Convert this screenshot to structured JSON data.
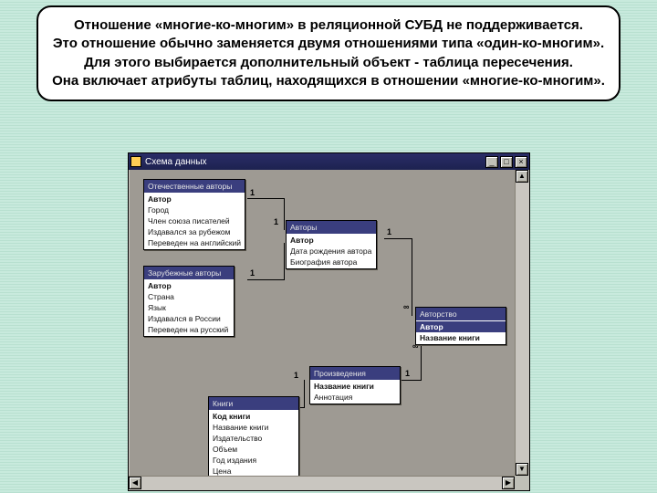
{
  "callout": "Отношение «многие-ко-многим» в реляционной СУБД не поддерживается.\nЭто отношение обычно заменяется двумя отношениями типа «один-ко-многим». Для этого выбирается дополнительный объект - таблица пересечения.\nОна включает атрибуты таблиц, находящихся в отношении «многие-ко-многим».",
  "window": {
    "title": "Схема данных",
    "btn_min": "_",
    "btn_max": "□",
    "btn_close": "×",
    "sb_up": "▲",
    "sb_down": "▼",
    "sb_left": "◀",
    "sb_right": "▶"
  },
  "tables": {
    "t1": {
      "title": "Отечественные авторы",
      "f0": "Автор",
      "f1": "Город",
      "f2": "Член союза писателей",
      "f3": "Издавался за рубежом",
      "f4": "Переведен на английский"
    },
    "t2": {
      "title": "Авторы",
      "f0": "Автор",
      "f1": "Дата рождения автора",
      "f2": "Биография автора"
    },
    "t3": {
      "title": "Зарубежные авторы",
      "f0": "Автор",
      "f1": "Страна",
      "f2": "Язык",
      "f3": "Издавался в России",
      "f4": "Переведен на русский"
    },
    "t4": {
      "title": "Авторство",
      "f0": "Автор",
      "f1": "Название книги"
    },
    "t5": {
      "title": "Произведения",
      "f0": "Название книги",
      "f1": "Аннотация"
    },
    "t6": {
      "title": "Книги",
      "f0": "Код книги",
      "f1": "Название книги",
      "f2": "Издательство",
      "f3": "Объем",
      "f4": "Год издания",
      "f5": "Цена"
    }
  },
  "rel": {
    "one": "1",
    "many": "∞"
  }
}
